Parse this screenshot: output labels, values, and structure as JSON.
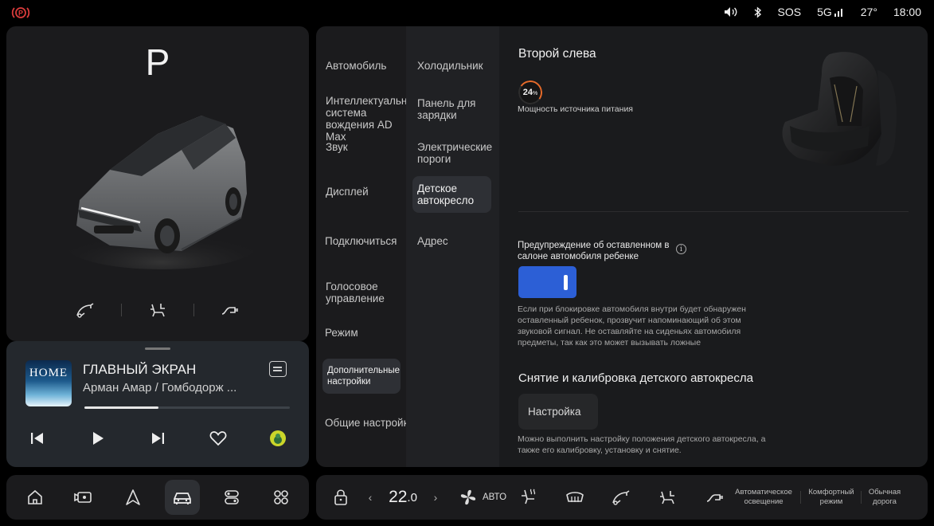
{
  "status_bar": {
    "sos": "SOS",
    "network": "5G",
    "temperature": "27°",
    "time": "18:00",
    "icons": [
      "parking-brake-icon",
      "volume-icon",
      "bluetooth-icon",
      "signal-icon"
    ]
  },
  "vehicle": {
    "gear": "P",
    "quick_controls": [
      "charge-port-icon",
      "rear-seat-icon",
      "power-outlet-icon"
    ]
  },
  "media": {
    "cover_text": "HOME",
    "title": "ГЛАВНЫЙ ЭКРАН",
    "artist": "Арман Амар / Гомбодорж ...",
    "progress": 0.36
  },
  "dock": {
    "items": [
      "home-icon",
      "camera-icon",
      "navigation-icon",
      "car-icon",
      "settings-toggle-icon",
      "apps-grid-icon"
    ],
    "active": "car-icon"
  },
  "settings_menu": {
    "col1": [
      "Автомобиль",
      "Интеллектуальная система вождения AD Max",
      "Звук",
      "Дисплей",
      "Подключиться",
      "Голосовое управление",
      "Режим",
      "Дополнительные настройки",
      "Общие настройки"
    ],
    "col2": [
      "Холодильник",
      "Панель для зарядки",
      "Электрические пороги",
      "Детское автокресло",
      "Адрес"
    ]
  },
  "child_seat": {
    "title": "Второй слева",
    "battery_value": "24",
    "battery_unit": "%",
    "battery_fraction": 0.24,
    "power_label": "Мощность источника питания",
    "warning_title": "Предупреждение об оставленном в салоне автомобиля ребенке",
    "warning_enabled": true,
    "warning_desc": "Если при блокировке автомобиля внутри будет обнаружен оставленный ребенок, прозвучит напоминающий об этом звуковой сигнал. Не оставляйте на сиденьях автомобиля предметы, так как это может вызывать ложные",
    "calib_title": "Снятие и калибровка детского автокресла",
    "calib_button": "Настройка",
    "calib_desc": "Можно выполнить настройку положения детского автокресла, а также его калибровку, установку и снятие."
  },
  "climate": {
    "temp_int": "22",
    "temp_dec": ".0",
    "fan_mode": "АВТО",
    "mode_auto_light": "Автоматическое освещение",
    "mode_comfort": "Комфортный режим",
    "mode_normal_road": "Обычная дорога",
    "accent_color": "#2c5fd6",
    "battery_ring_color": "#e56a2a"
  }
}
